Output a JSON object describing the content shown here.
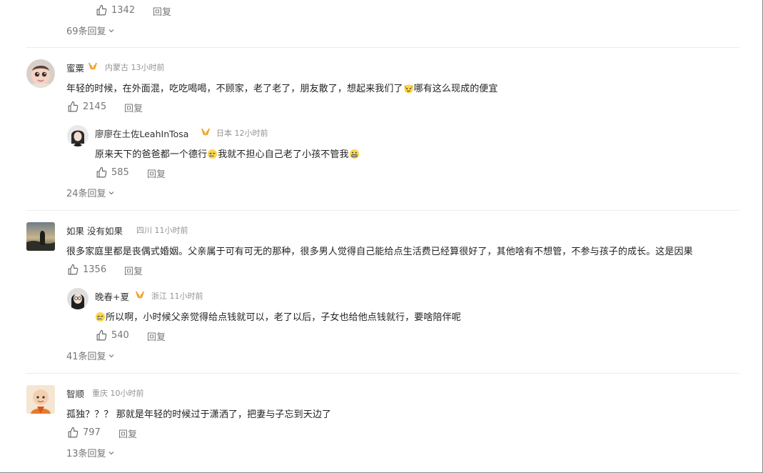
{
  "top": {
    "likes": "1342",
    "reply": "回复",
    "more": "69条回复"
  },
  "c1": {
    "name": "蜜粟",
    "location": "内蒙古",
    "time": "13小时前",
    "text_a": "年轻的时候，在外面混，吃吃喝喝，不顾家，老了老了，朋友散了，想起来我们了",
    "text_b": "哪有这么现成的便宜",
    "likes": "2145",
    "reply": "回复",
    "sub": {
      "name": "廖廖在土佐LeahInTosa",
      "location": "日本",
      "time": "12小时前",
      "text_a": "原来天下的爸爸都一个德行",
      "text_b": "我就不担心自己老了小孩不管我",
      "likes": "585",
      "reply": "回复"
    },
    "more": "24条回复"
  },
  "c2": {
    "name": "如果 没有如果",
    "location": "四川",
    "time": "11小时前",
    "text": "很多家庭里都是丧偶式婚姻。父亲属于可有可无的那种，很多男人觉得自己能给点生活费已经算很好了，其他啥有不想管，不参与孩子的成长。这是因果",
    "likes": "1356",
    "reply": "回复",
    "sub": {
      "name": "晚春+夏",
      "location": "浙江",
      "time": "11小时前",
      "text": "所以啊，小时候父亲觉得给点钱就可以，老了以后，子女也给他点钱就行，要啥陪伴呢",
      "likes": "540",
      "reply": "回复"
    },
    "more": "41条回复"
  },
  "c3": {
    "name": "智顺",
    "location": "重庆",
    "time": "10小时前",
    "text": "孤独？？？ 那就是年轻的时候过于潇洒了，把妻与子忘到天边了",
    "likes": "797",
    "reply": "回复",
    "more": "13条回复"
  },
  "colors": {
    "vip_badge": "#f0a020",
    "meta": "#939393",
    "action": "#777777"
  }
}
